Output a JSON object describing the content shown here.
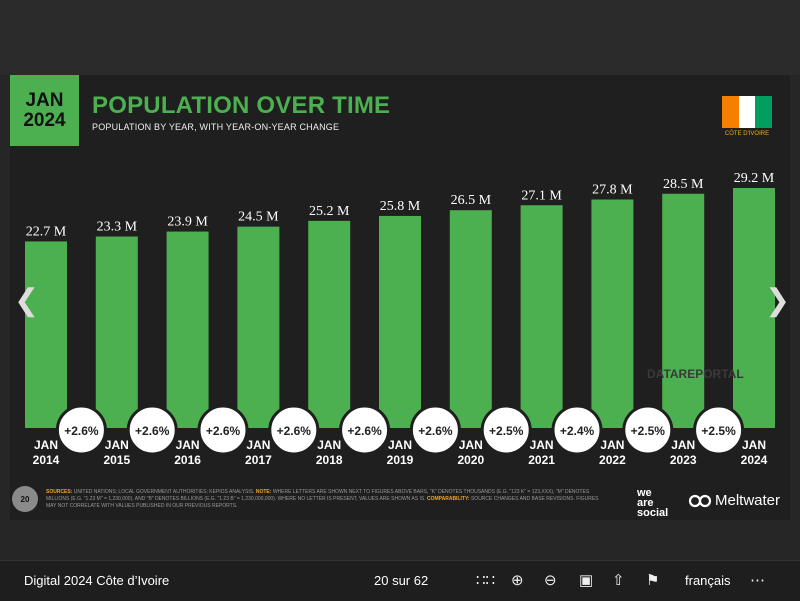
{
  "header": {
    "date_line1": "JAN",
    "date_line2": "2024",
    "title": "POPULATION OVER TIME",
    "subtitle": "POPULATION BY YEAR, WITH YEAR-ON-YEAR CHANGE",
    "country": "CÔTE D'IVOIRE",
    "flag_colors": [
      "#f77f00",
      "#ffffff",
      "#009e60"
    ]
  },
  "watermark": "DATAREPORTAL",
  "footer": {
    "slide_number": "20",
    "sources_label": "SOURCES:",
    "sources_text": "UNITED NATIONS; LOCAL GOVERNMENT AUTHORITIES; KEPIOS ANALYSIS.",
    "note_label": "NOTE:",
    "note_text": "WHERE LETTERS ARE SHOWN NEXT TO FIGURES ABOVE BARS, \"K\" DENOTES THOUSANDS (E.G. \"123 K\" = 123,XXX), \"M\" DENOTES MILLIONS (E.G. \"1.23 M\" = 1,230,000), AND \"B\" DENOTES BILLIONS (E.G. \"1.23 B\" = 1,230,000,000). WHERE NO LETTER IS PRESENT, VALUES ARE SHOWN AS IS.",
    "comparability_label": "COMPARABILITY:",
    "comparability_text": "SOURCE CHANGES AND BASE REVISIONS. FIGURES MAY NOT CORRELATE WITH VALUES PUBLISHED IN OUR PREVIOUS REPORTS.",
    "brand1_line1": "we",
    "brand1_line2": "are",
    "brand1_line3": "social",
    "brand2": "Meltwater"
  },
  "viewer": {
    "doc_title": "Digital 2024 Côte d’Ivoire",
    "page": "20 sur 62",
    "language": "français",
    "prev_icon": "chevron-left-icon",
    "next_icon": "chevron-right-icon"
  },
  "chart_data": {
    "type": "bar",
    "title": "POPULATION OVER TIME",
    "subtitle": "POPULATION BY YEAR, WITH YEAR-ON-YEAR CHANGE",
    "categories": [
      "JAN 2014",
      "JAN 2015",
      "JAN 2016",
      "JAN 2017",
      "JAN 2018",
      "JAN 2019",
      "JAN 2020",
      "JAN 2021",
      "JAN 2022",
      "JAN 2023",
      "JAN 2024"
    ],
    "values": [
      22.7,
      23.3,
      23.9,
      24.5,
      25.2,
      25.8,
      26.5,
      27.1,
      27.8,
      28.5,
      29.2
    ],
    "value_labels": [
      "22.7 M",
      "23.3 M",
      "23.9 M",
      "24.5 M",
      "25.2 M",
      "25.8 M",
      "26.5 M",
      "27.1 M",
      "27.8 M",
      "28.5 M",
      "29.2 M"
    ],
    "changes": [
      "+2.6%",
      "+2.6%",
      "+2.6%",
      "+2.6%",
      "+2.6%",
      "+2.6%",
      "+2.5%",
      "+2.4%",
      "+2.5%",
      "+2.5%"
    ],
    "unit": "M",
    "bar_color": "#4caf50"
  }
}
